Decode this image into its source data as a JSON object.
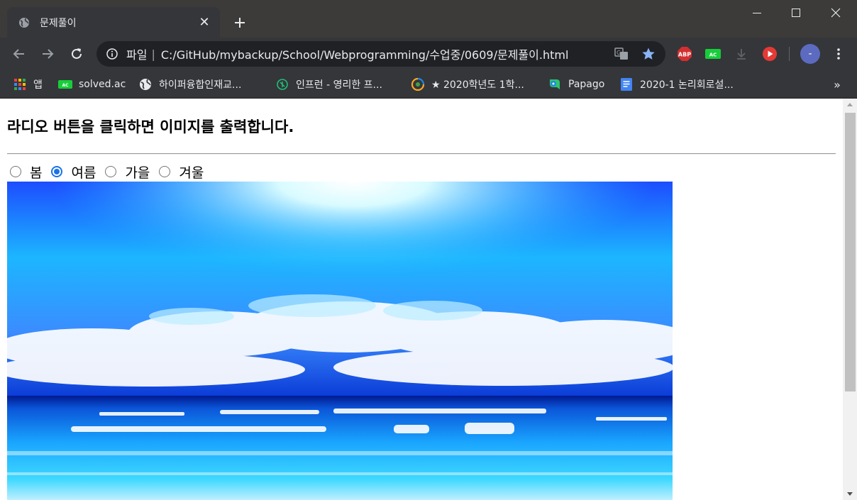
{
  "colors": {
    "accent": "#1a73e8",
    "titlebar": "#3c3b39",
    "toolbar": "#35363a",
    "omnibox": "#202124"
  },
  "tab": {
    "title": "문제풀이",
    "icon": "globe-icon"
  },
  "omnibox": {
    "scheme_label": "파일",
    "separator": "|",
    "url": "C:/GitHub/mybackup/School/Webprogramming/수업중/0609/문제풀이.html"
  },
  "extensions": {
    "adblock": "ABP",
    "solved": "AC"
  },
  "profile": {
    "initial": "-"
  },
  "bookmarks": [
    {
      "label": "앱",
      "icon": "apps-grid-icon"
    },
    {
      "label": "solved.ac",
      "icon": "solved-ac-icon"
    },
    {
      "label": "하이퍼융합인재교...",
      "icon": "globe-icon"
    },
    {
      "label": "인프런 - 영리한 프...",
      "icon": "inflearn-icon"
    },
    {
      "label": "★ 2020학년도 1학...",
      "icon": "school-logo-icon"
    },
    {
      "label": "Papago",
      "icon": "papago-icon"
    },
    {
      "label": "2020-1 논리회로설...",
      "icon": "google-docs-icon"
    }
  ],
  "bookmarks_more": "»",
  "page": {
    "heading": "라디오 버튼을 클릭하면 이미지를 출력합니다.",
    "seasons": [
      {
        "label": "봄",
        "checked": false
      },
      {
        "label": "여름",
        "checked": true
      },
      {
        "label": "가을",
        "checked": false
      },
      {
        "label": "겨울",
        "checked": false
      }
    ],
    "image": "summer-beach-image"
  }
}
